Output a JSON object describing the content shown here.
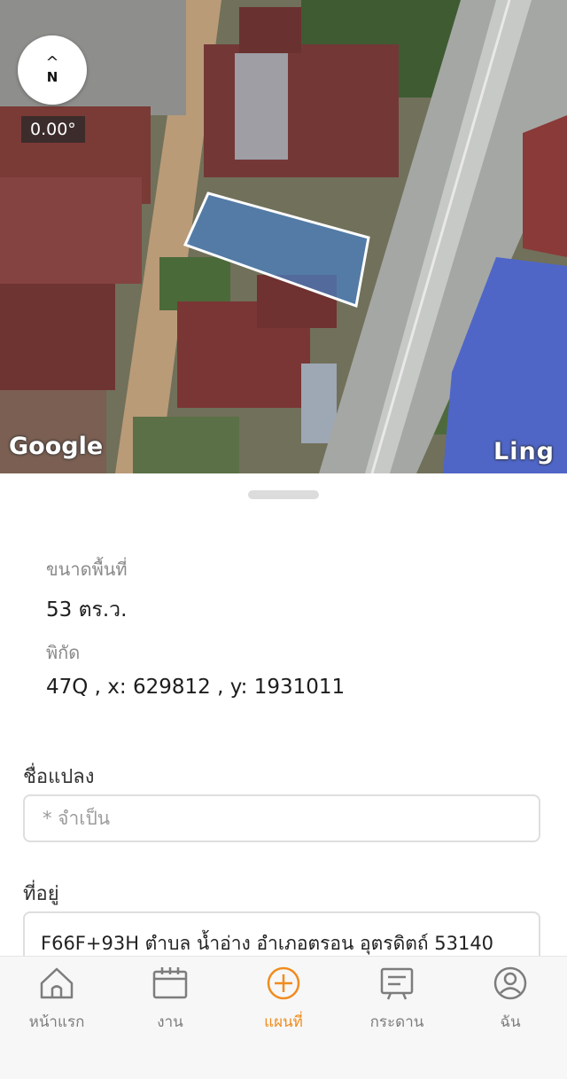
{
  "map": {
    "bearing": "0.00°",
    "compass_letter": "N",
    "compass_arrow": "^",
    "attribution": "Google",
    "road_label": "Ling",
    "parcel_fill_color": "#4a7fc0"
  },
  "parcel_info": {
    "area_label": "ขนาดพื้นที่",
    "area_value": "53 ตร.ว.",
    "coords_label": "พิกัด",
    "coords_value": "47Q , x: 629812 , y: 1931011"
  },
  "form": {
    "name_label": "ชื่อแปลง",
    "name_placeholder": "* จำเป็น",
    "address_label": "ที่อยู่",
    "address_value": "F66F+93H ตำบล น้ำอ่าง อำเภอตรอน อุตรดิตถ์ 53140"
  },
  "tabbar": {
    "accent_color": "#f08c1e",
    "tabs": [
      {
        "label": "หน้าแรก",
        "icon": "home-icon",
        "active": false
      },
      {
        "label": "งาน",
        "icon": "calendar-icon",
        "active": false
      },
      {
        "label": "แผนที่",
        "icon": "add-circle-icon",
        "active": true
      },
      {
        "label": "กระดาน",
        "icon": "board-icon",
        "active": false
      },
      {
        "label": "ฉัน",
        "icon": "profile-icon",
        "active": false
      }
    ]
  }
}
